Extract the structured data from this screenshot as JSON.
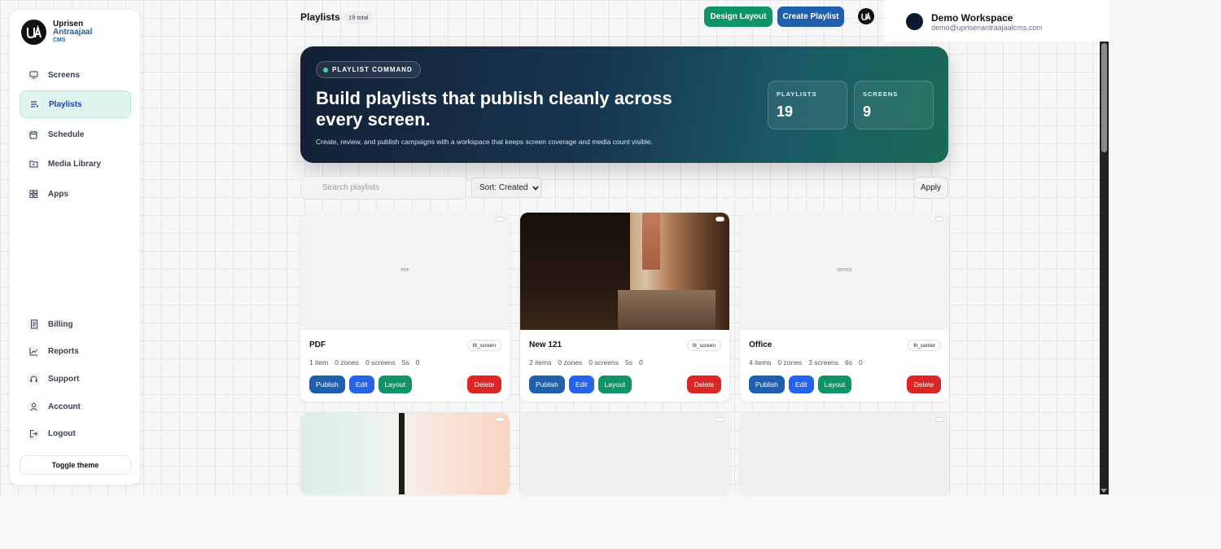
{
  "brand": {
    "name": "Uprisen",
    "sub": "Antraajaal",
    "cms": "CMS"
  },
  "sidebar": {
    "items": [
      {
        "label": "Screens",
        "icon": "monitor-icon"
      },
      {
        "label": "Playlists",
        "icon": "playlist-icon",
        "active": true
      },
      {
        "label": "Schedule",
        "icon": "calendar-icon"
      },
      {
        "label": "Media Library",
        "icon": "folder-icon"
      },
      {
        "label": "Apps",
        "icon": "apps-icon"
      }
    ],
    "bottom_items": [
      {
        "label": "Billing",
        "icon": "receipt-icon"
      },
      {
        "label": "Reports",
        "icon": "chart-icon"
      },
      {
        "label": "Support",
        "icon": "headset-icon"
      },
      {
        "label": "Account",
        "icon": "user-icon"
      },
      {
        "label": "Logout",
        "icon": "logout-icon"
      }
    ],
    "toggle_theme": "Toggle theme"
  },
  "header": {
    "title": "Playlists",
    "count": "19 total",
    "design_layout": "Design Layout",
    "create_playlist": "Create Playlist"
  },
  "workspace": {
    "name": "Demo Workspace",
    "email": "demo@uprisenantraajaalcms.com"
  },
  "hero": {
    "pill": "PLAYLIST COMMAND",
    "title": "Build playlists that publish cleanly across every screen.",
    "description": "Create, review, and publish campaigns with a workspace that keeps screen coverage and media count visible.",
    "stats": [
      {
        "label": "PLAYLISTS",
        "value": "19"
      },
      {
        "label": "SCREENS",
        "value": "9"
      }
    ]
  },
  "controls": {
    "search_placeholder": "Search playlists",
    "sort_value": "Sort: Created",
    "apply": "Apply"
  },
  "cards": [
    {
      "name": "PDF",
      "thumb_label": "PDF",
      "fit": "fit_screen",
      "items": "1 item",
      "zones": "0 zones",
      "screens": "0 screens",
      "duration": "5s",
      "extra": "0"
    },
    {
      "name": "New 121",
      "thumb_label": "",
      "fit": "fit_screen",
      "items": "2 items",
      "zones": "0 zones",
      "screens": "0 screens",
      "duration": "5s",
      "extra": "0"
    },
    {
      "name": "Office",
      "thumb_label": "OFFICE",
      "fit": "fit_center",
      "items": "4 items",
      "zones": "0 zones",
      "screens": "3 screens",
      "duration": "6s",
      "extra": "0"
    }
  ],
  "card_actions": {
    "publish": "Publish",
    "edit": "Edit",
    "layout": "Layout",
    "delete": "Delete"
  },
  "colors": {
    "primary_blue": "#1f5fae",
    "edit_blue": "#2563eb",
    "green": "#0f9466",
    "danger": "#dc2626"
  }
}
